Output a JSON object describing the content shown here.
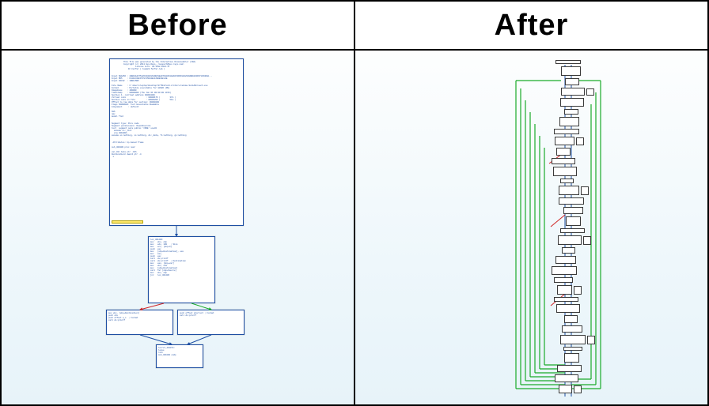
{
  "labels": {
    "before": "Before",
    "after": "After"
  },
  "before": {
    "header_block": "          This file was generated by the Interactive Disassembler (IDA)\n          Copyright (c) 2011 Hex-Rays, <support@hex-rays.com>\n                    License info: 48-37E2-8221-47\n              Dr.Farfar ( team24-farfar.lab )\n\n\nInput SHA256 : 29B19A4F754264340C8649E51EA07190261AA1DF3D6F8A62688DB9483D371364DA0...\nInput MD5    : F10AC34AFF578745FE3E1A7B2E3AF24E\nInput CRC32  : 1DB115B5\n\nFile Name    : C:\\Users\\laptop\\Desktop\\SrfOndrozd.crstin\\crackme-SolidScreech.exe\nFormat       : Portable executable for 80386 (PE)\nImagebase    : 400000\nTimestamp    : 00000000 (Thu Jan 01 00:00:00 1970)\nSection 1. (virtual address 00001000)\nVirtual size                 : 00000176 (        374.)\nSection size in file         : 00000200 (        512.)\nOffset to raw data for section: 00000200\nFlags 60000020: Text Executable Readable\nAlignment     : default\n\n686\nnmx\nmodel flat\n\n\nSegment type: Pure code\nSegment permissions: Read/Execute\ntext  segment para public 'CODE' use32\n  assume cs:_text\n  org 401000h\nassume es:nothing, ss:nothing, ds:_data, fs:nothing, gs:nothing\n\n\n Attributes: bp-based frame\n\nsub_401000 proc near\n\nvar_C0= byte ptr -C0h\nDestination= dword ptr -4\n s",
    "block2": "loc_401206:\nmov   ebx, ebp\nmov   edx, 100   ; Size\nmov   ecx, [ebp+4]\npush  eax\nmov   [ebp+Destination], eax\nmov   eax,\npush  eax\ncall  ds:printf\ncall  ds:printf  ; Destination\nmov   eax, [ebp+var]\nmov   ebx, edi\nmov   [ebp+Destination]\ncall  far [ebp+Source]\nmov   ebx, ebp\njnz   loc_401206",
    "block3a": "mov ebx, [ebp+Destination]\npush ebx\npush offset a_s  ; Format\ncall ds:printf",
    "block3b": "push offset aCorrect ; Format\ncall ds:printf",
    "block4": "locret_401074:\nleave\nretn\nsub_401000 endp"
  },
  "colors": {
    "edge_default": "#1e4fa3",
    "edge_true": "#1aab2a",
    "edge_false": "#d02626",
    "node_border": "#1e4fa3"
  }
}
